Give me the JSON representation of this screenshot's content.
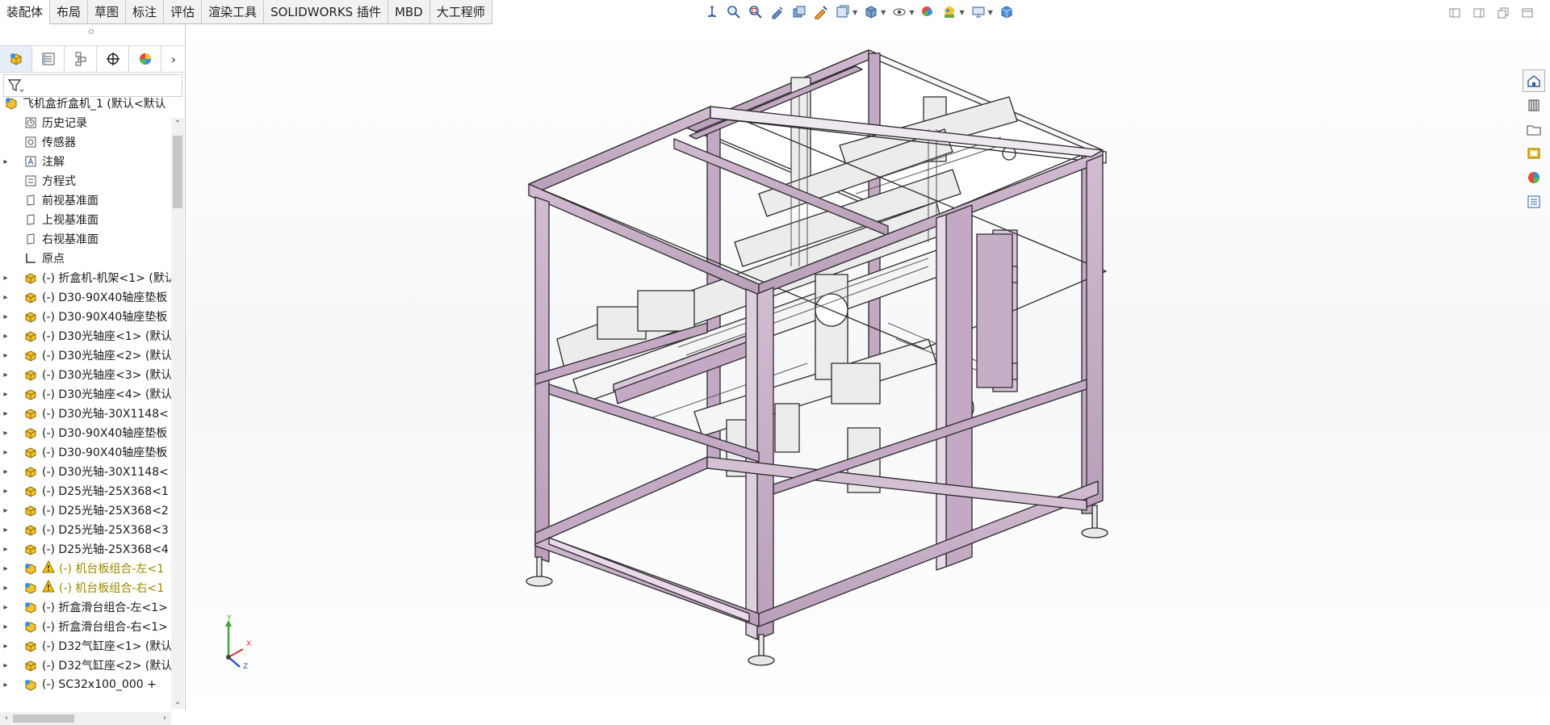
{
  "tabs": [
    {
      "label": "装配体",
      "active": true
    },
    {
      "label": "布局",
      "active": false
    },
    {
      "label": "草图",
      "active": false
    },
    {
      "label": "标注",
      "active": false
    },
    {
      "label": "评估",
      "active": false
    },
    {
      "label": "渲染工具",
      "active": false
    },
    {
      "label": "SOLIDWORKS 插件",
      "active": false
    },
    {
      "label": "MBD",
      "active": false
    },
    {
      "label": "大工程师",
      "active": false
    }
  ],
  "hud_tools": [
    "view-orientation-icon",
    "zoom-to-fit-icon",
    "zoom-to-area-icon",
    "previous-view-icon",
    "section-view-icon",
    "dynamic-annotation-icon",
    "view-settings-icon",
    "display-style-icon",
    "hide-show-items-icon",
    "edit-appearance-icon",
    "apply-scene-icon",
    "view-settings-monitor-icon",
    "3d-view-icon"
  ],
  "window_controls": [
    "previous-doc-icon",
    "next-doc-icon",
    "restore-icon",
    "close-icon"
  ],
  "feature_manager": {
    "tabs": [
      "featuremanager-tab",
      "propertymanager-tab",
      "configurationmanager-tab",
      "dimxpert-tab",
      "displaymanager-tab"
    ],
    "filter_icon": "filter-icon",
    "root": "飞机盒折盒机_1 (默认<默认",
    "folders": [
      {
        "label": "历史记录",
        "icon": "history-icon",
        "expandable": false
      },
      {
        "label": "传感器",
        "icon": "sensor-icon",
        "expandable": false
      },
      {
        "label": "注解",
        "icon": "annotation-icon",
        "expandable": true
      },
      {
        "label": "方程式",
        "icon": "equation-icon",
        "expandable": false
      },
      {
        "label": "前视基准面",
        "icon": "plane-icon",
        "expandable": false
      },
      {
        "label": "上视基准面",
        "icon": "plane-icon",
        "expandable": false
      },
      {
        "label": "右视基准面",
        "icon": "plane-icon",
        "expandable": false
      },
      {
        "label": "原点",
        "icon": "origin-icon",
        "expandable": false
      }
    ],
    "components": [
      {
        "label": "(-) 折盒机-机架<1> (默认",
        "kind": "part",
        "warning": false
      },
      {
        "label": "(-) D30-90X40轴座垫板",
        "kind": "part",
        "warning": false
      },
      {
        "label": "(-) D30-90X40轴座垫板",
        "kind": "part",
        "warning": false
      },
      {
        "label": "(-) D30光轴座<1> (默认",
        "kind": "part",
        "warning": false
      },
      {
        "label": "(-) D30光轴座<2> (默认",
        "kind": "part",
        "warning": false
      },
      {
        "label": "(-) D30光轴座<3> (默认",
        "kind": "part",
        "warning": false
      },
      {
        "label": "(-) D30光轴座<4> (默认",
        "kind": "part",
        "warning": false
      },
      {
        "label": "(-) D30光轴-30X1148<",
        "kind": "part",
        "warning": false
      },
      {
        "label": "(-) D30-90X40轴座垫板",
        "kind": "part",
        "warning": false
      },
      {
        "label": "(-) D30-90X40轴座垫板",
        "kind": "part",
        "warning": false
      },
      {
        "label": "(-) D30光轴-30X1148<",
        "kind": "part",
        "warning": false
      },
      {
        "label": "(-) D25光轴-25X368<1",
        "kind": "part",
        "warning": false
      },
      {
        "label": "(-) D25光轴-25X368<2",
        "kind": "part",
        "warning": false
      },
      {
        "label": "(-) D25光轴-25X368<3",
        "kind": "part",
        "warning": false
      },
      {
        "label": "(-) D25光轴-25X368<4",
        "kind": "part",
        "warning": false
      },
      {
        "label": "(-) 机台板组合-左<1",
        "kind": "assembly",
        "warning": true
      },
      {
        "label": "(-) 机台板组合-右<1",
        "kind": "assembly",
        "warning": true
      },
      {
        "label": "(-) 折盒滑台组合-左<1>",
        "kind": "assembly",
        "warning": false
      },
      {
        "label": "(-) 折盒滑台组合-右<1>",
        "kind": "assembly",
        "warning": false
      },
      {
        "label": "(-) D32气缸座<1> (默认",
        "kind": "part",
        "warning": false
      },
      {
        "label": "(-) D32气缸座<2> (默认",
        "kind": "part",
        "warning": false
      },
      {
        "label": "(-) SC32x100_000 +",
        "kind": "assembly",
        "warning": false
      }
    ]
  },
  "triad": {
    "y": "Y",
    "x": "X",
    "z": "Z"
  },
  "task_pane": [
    "solidworks-resources-icon",
    "design-library-icon",
    "file-explorer-icon",
    "view-palette-icon",
    "appearances-scenes-icon",
    "custom-properties-icon"
  ],
  "colors": {
    "frame_fill": "#c7aec7",
    "frame_face": "#f7f2f7",
    "edge": "#2a2a2a",
    "accent_blue": "#1f6fb2",
    "warning_text": "#9a8a00"
  }
}
